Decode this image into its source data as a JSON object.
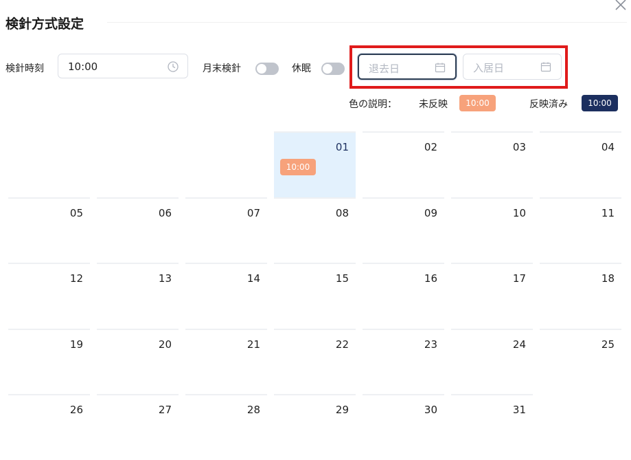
{
  "header": {
    "title": "検針方式設定"
  },
  "form": {
    "reading_time_label": "検針時刻",
    "reading_time_value": "10:00",
    "month_end_label": "月末検針",
    "dormant_label": "休眠",
    "move_out_placeholder": "退去日",
    "move_in_placeholder": "入居日"
  },
  "legend": {
    "title": "色の説明：",
    "unreflected_label": "未反映",
    "unreflected_chip": "10:00",
    "reflected_label": "反映済み",
    "reflected_chip": "10:00"
  },
  "calendar": {
    "days": [
      "01",
      "02",
      "03",
      "04",
      "05",
      "06",
      "07",
      "08",
      "09",
      "10",
      "11",
      "12",
      "13",
      "14",
      "15",
      "16",
      "17",
      "18",
      "19",
      "20",
      "21",
      "22",
      "23",
      "24",
      "25",
      "26",
      "27",
      "28",
      "29",
      "30",
      "31"
    ],
    "selected_day": "01",
    "selected_chip": "10:00"
  },
  "colors": {
    "unreflected": "#f7a27b",
    "reflected": "#1c2f5f",
    "selected_cell_bg": "#e3f1fd",
    "highlight_border": "#e01b1b"
  }
}
